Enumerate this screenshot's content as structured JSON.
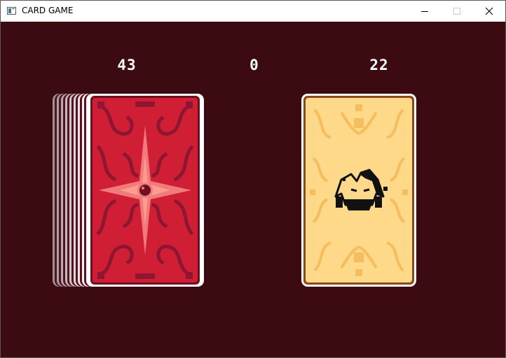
{
  "window": {
    "title": "CARD GAME",
    "buttons": [
      "minimize",
      "maximize",
      "close"
    ]
  },
  "scores": {
    "left": "43",
    "center": "0",
    "right": "22"
  },
  "colors": {
    "background": "#3b0b11",
    "card_back": "#d01f35",
    "card_back_border": "#7a1022",
    "card_face": "#ffd98a",
    "card_face_border": "#8a4a1a",
    "text": "#ffffff"
  },
  "cards": {
    "deck": {
      "face": "back"
    },
    "played": {
      "face": "joker"
    }
  }
}
